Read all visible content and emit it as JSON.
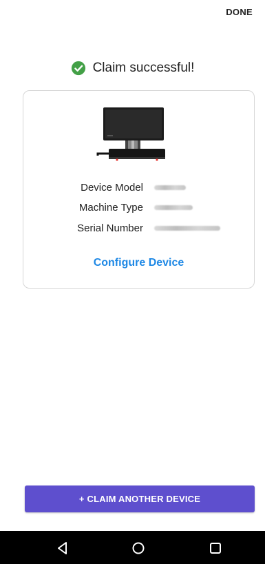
{
  "header": {
    "done_label": "DONE"
  },
  "status": {
    "message": "Claim successful!",
    "icon": "check-circle-icon",
    "icon_color": "#43a047"
  },
  "device_card": {
    "image": "device-dock-image",
    "details": [
      {
        "label": "Device Model"
      },
      {
        "label": "Machine Type"
      },
      {
        "label": "Serial Number"
      }
    ],
    "configure_label": "Configure Device",
    "link_color": "#1e88e5"
  },
  "footer": {
    "claim_another_label": "+ CLAIM ANOTHER DEVICE",
    "button_color": "#5e4fce"
  },
  "system_nav": {
    "back_icon": "back-triangle-icon",
    "home_icon": "home-circle-icon",
    "recents_icon": "recents-square-icon"
  }
}
